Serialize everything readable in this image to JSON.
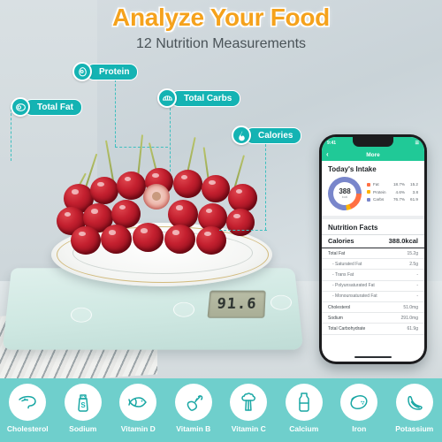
{
  "headline": "Analyze Your Food",
  "subheadline": "12 Nutrition Measurements",
  "colors": {
    "accent_orange": "#F5A21C",
    "teal": "#14b3b3",
    "strip_teal": "#6fcfcc",
    "app_green": "#20c997",
    "fat": "#ff7043",
    "protein": "#ffb300",
    "carbs": "#7986cb"
  },
  "callouts": [
    {
      "label": "Total Fat",
      "icon": "steak-icon"
    },
    {
      "label": "Protein",
      "icon": "egg-icon"
    },
    {
      "label": "Total Carbs",
      "icon": "bread-icon"
    },
    {
      "label": "Calories",
      "icon": "flame-icon"
    }
  ],
  "scale": {
    "display_value": "91.6"
  },
  "phone": {
    "status": {
      "time": "9:41",
      "carrier": "",
      "battery": ""
    },
    "nav": {
      "back_icon": "chevron-left-icon",
      "title": "More"
    },
    "intake": {
      "title": "Today's Intake",
      "total_value": "388",
      "total_unit": "kcal",
      "macros": [
        {
          "name": "Fat",
          "percent": "18.7%",
          "grams": "15.2",
          "color": "#ff7043"
        },
        {
          "name": "Protein",
          "percent": "4.6%",
          "grams": "3.8",
          "color": "#ffb300"
        },
        {
          "name": "Carbs",
          "percent": "76.7%",
          "grams": "61.9",
          "color": "#7986cb"
        }
      ]
    },
    "facts": {
      "title": "Nutrition Facts",
      "calories_label": "Calories",
      "calories_value": "388.0kcal",
      "rows": [
        {
          "label": "Total Fat",
          "value": "15.2g",
          "sub": false
        },
        {
          "label": "- Saturated Fat",
          "value": "2.5g",
          "sub": true
        },
        {
          "label": "- Trans Fat",
          "value": "-",
          "sub": true
        },
        {
          "label": "- Polyunsaturated Fat",
          "value": "-",
          "sub": true
        },
        {
          "label": "- Monounsaturated Fat",
          "value": "-",
          "sub": true
        },
        {
          "label": "Cholesterol",
          "value": "51.0mg",
          "sub": false
        },
        {
          "label": "Sodium",
          "value": "291.0mg",
          "sub": false
        },
        {
          "label": "Total Carbohydrate",
          "value": "61.9g",
          "sub": false
        }
      ]
    }
  },
  "nutrient_strip": [
    {
      "label": "Cholesterol",
      "icon": "liver-icon"
    },
    {
      "label": "Sodium",
      "icon": "salt-shaker-icon"
    },
    {
      "label": "Vitamin D",
      "icon": "fish-icon"
    },
    {
      "label": "Vitamin B",
      "icon": "carrot-icon"
    },
    {
      "label": "Vitamin C",
      "icon": "broccoli-icon"
    },
    {
      "label": "Calcium",
      "icon": "milk-bottle-icon"
    },
    {
      "label": "Iron",
      "icon": "lemon-icon"
    },
    {
      "label": "Potassium",
      "icon": "banana-icon"
    }
  ]
}
